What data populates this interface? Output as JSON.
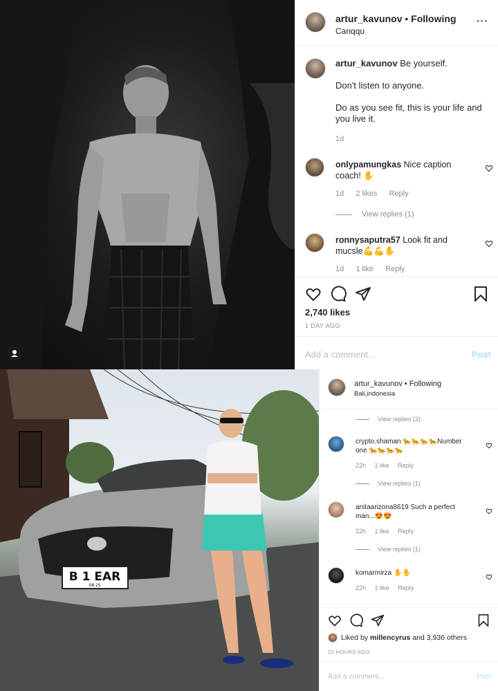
{
  "post1": {
    "username": "artur_kavunov",
    "follow_label": "Following",
    "location": "Canqqu",
    "caption": {
      "username": "artur_kavunov",
      "line1": "Be yourself.",
      "line2": "Don't listen to anyone.",
      "line3": "Do as you see fit, this is your life and you live it.",
      "time": "1d"
    },
    "comments": [
      {
        "username": "onlypamungkas",
        "text": "Nice caption coach! ✋",
        "time": "1d",
        "likes": "2 likes",
        "reply": "Reply"
      },
      {
        "username": "ronnysaputra57",
        "text": "Look fit and mucsle💪💪✋",
        "time": "1d",
        "likes": "1 like",
        "reply": "Reply"
      }
    ],
    "view_replies": "View replies (1)",
    "likes": "2,740 likes",
    "time_ago": "1 DAY AGO",
    "add_comment_placeholder": "Add a comment...",
    "post_label": "Post"
  },
  "post2": {
    "username": "artur_kavunov",
    "follow_label": "Following",
    "location": "Bali,indonesia",
    "view_replies_top": "View replies (2)",
    "comments": [
      {
        "username": "crypto.shaman",
        "text": "🐆🐆🐆🐆Number one 🐆🐆🐆🐆",
        "time": "22h",
        "likes": "1 like",
        "reply": "Reply",
        "view_replies": "View replies (1)"
      },
      {
        "username": "anitaarizona8619",
        "text": "Such a perfect man...😍😍",
        "time": "22h",
        "likes": "1 like",
        "reply": "Reply",
        "view_replies": "View replies (1)"
      },
      {
        "username": "komarmirza",
        "text": "✋✋",
        "time": "22h",
        "likes": "1 like",
        "reply": "Reply"
      }
    ],
    "liked_by_prefix": "Liked by",
    "liked_by_user": "millencyrus",
    "liked_by_and": "and",
    "liked_by_others": "3,936 others",
    "time_ago": "22 HOURS AGO",
    "add_comment_placeholder": "Add a comment...",
    "post_label": "Post",
    "plate_text": "B 1 EAR",
    "plate_sub": "08·25"
  },
  "icons": {
    "heart": "heart-icon",
    "comment": "comment-icon",
    "share": "share-icon",
    "bookmark": "bookmark-icon",
    "more": "more-icon",
    "user_tag": "user-tag-icon"
  },
  "colors": {
    "text": "#262626",
    "muted": "#8e8e8e",
    "post_disabled": "#b2dffc",
    "border": "#dbdbdb"
  }
}
